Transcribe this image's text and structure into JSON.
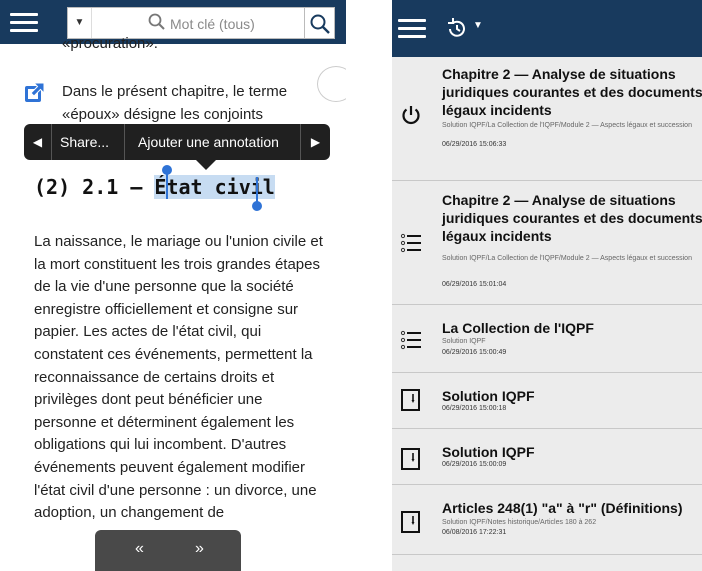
{
  "left": {
    "search": {
      "placeholder": "Mot clé (tous)"
    },
    "clipped_text": "«procuration».",
    "para1": "Dans le présent chapitre, le terme «époux» désigne les conjoints",
    "context_menu": {
      "share": "Share...",
      "annotate": "Ajouter une annotation"
    },
    "heading": {
      "prefix": "(2) 2.1 —",
      "selected": "État civil"
    },
    "body": "La naissance, le mariage ou l'union civile et la mort constituent les trois grandes étapes de la vie d'une personne que la société enregistre officiellement et consigne sur papier. Les actes de l'état civil, qui constatent ces événements, permettent la reconnaissance de certains droits et privilèges dont peut bénéficier une personne et déterminent également les obligations qui lui incombent. D'autres événements peuvent également modifier l'état civil d'une personne : un divorce, une adoption, un changement de",
    "nav": {
      "back": "«",
      "forward": "»"
    }
  },
  "right": {
    "history_items": [
      {
        "icon": "power-icon",
        "title": "Chapitre 2 — Analyse de situations juridiques courantes et des documents légaux incidents",
        "path": "Solution IQPF/La Collection de l'IQPF/Module 2 — Aspects légaux et succession",
        "date": "06/29/2016 15:06:33"
      },
      {
        "icon": "list-icon",
        "title": "Chapitre 2 — Analyse de situations juridiques courantes et des documents légaux incidents",
        "path": "Solution IQPF/La Collection de l'IQPF/Module 2 — Aspects légaux et succession",
        "date": "06/29/2016 15:01:04"
      },
      {
        "icon": "list-icon",
        "title": "La Collection de l'IQPF",
        "path": "Solution IQPF",
        "date": "06/29/2016 15:00:49"
      },
      {
        "icon": "book-icon",
        "title": "Solution IQPF",
        "path": "",
        "date": "06/29/2016 15:00:18"
      },
      {
        "icon": "book-icon",
        "title": "Solution IQPF",
        "path": "",
        "date": "06/29/2016 15:00:09"
      },
      {
        "icon": "book-icon",
        "title": "Articles 248(1) \"a\" à \"r\" (Définitions)",
        "path": "Solution IQPF/Notes historique/Articles 180 à 262",
        "date": "06/08/2016 17:22:31"
      }
    ]
  },
  "colors": {
    "bar": "#183a5e",
    "selection": "#c7dcf2",
    "handle": "#2f73d6"
  }
}
